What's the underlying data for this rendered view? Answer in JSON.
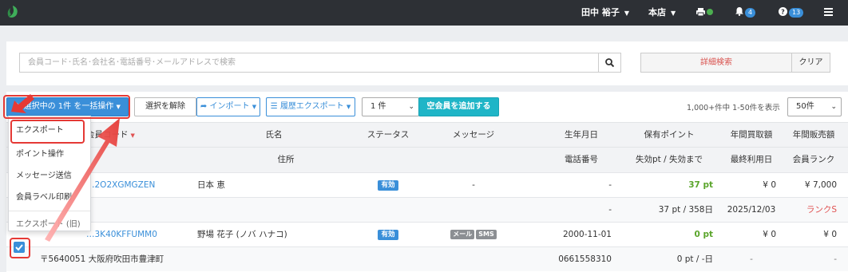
{
  "header": {
    "user": "田中 裕子",
    "store": "本店",
    "notifications": "4",
    "help": "13"
  },
  "search": {
    "placeholder": "会員コード･氏名･会社名･電話番号･メールアドレスで検索",
    "detail_label": "詳細検索",
    "clear_label": "クリア"
  },
  "toolbar": {
    "bulk_action": "選択中の 1件 を一括操作",
    "clear_selection": "選択を解除",
    "import": "インポート",
    "history_export": "履歴エクスポート",
    "count_select": "1 件",
    "add_vacant": "空会員を追加する",
    "paging_info": "1,000+件中 1-50件を表示",
    "per_page": "50件"
  },
  "dropdown": {
    "items": [
      "エクスポート",
      "ポイント操作",
      "メッセージ送信",
      "会員ラベル印刷"
    ],
    "legacy": "エクスポート (旧)"
  },
  "table": {
    "header_row1": {
      "code": "会員コード",
      "name": "氏名",
      "status": "ステータス",
      "message": "メッセージ",
      "birthday": "生年月日",
      "points": "保有ポイント",
      "annual_purchase": "年間買取額",
      "annual_sales": "年間販売額"
    },
    "header_row2": {
      "address": "住所",
      "phone": "電話番号",
      "expiry": "失効pt / 失効まで",
      "last_used": "最終利用日",
      "rank": "会員ランク"
    },
    "rows": [
      {
        "code": "…2O2XGMGZEN",
        "name": "日本 恵",
        "status": "有効",
        "message": "-",
        "birthday": "-",
        "points": "37 pt",
        "purchase": "¥ 0",
        "sales": "¥ 7,000",
        "address": "",
        "phone": "-",
        "expiry": "37 pt / 358日",
        "last_used": "2025/12/03",
        "rank": "ランクS"
      },
      {
        "code": "…3K40KFFUMM0",
        "name": "野場 花子 (ノバ ハナコ)",
        "status": "有効",
        "message_tags": [
          "メール",
          "SMS"
        ],
        "birthday": "2000-11-01",
        "points": "0 pt",
        "purchase": "¥ 0",
        "sales": "¥ 0",
        "address": "〒5640051 大阪府吹田市豊津町",
        "phone": "0661558310",
        "expiry": "0 pt / -日",
        "last_used": "-",
        "rank": "-"
      }
    ]
  },
  "colors": {
    "topbar": "#2d3035",
    "primary": "#3a8fd9",
    "teal": "#1fb5c7",
    "annotation_red": "#e53935",
    "points_green": "#5aa52b"
  }
}
